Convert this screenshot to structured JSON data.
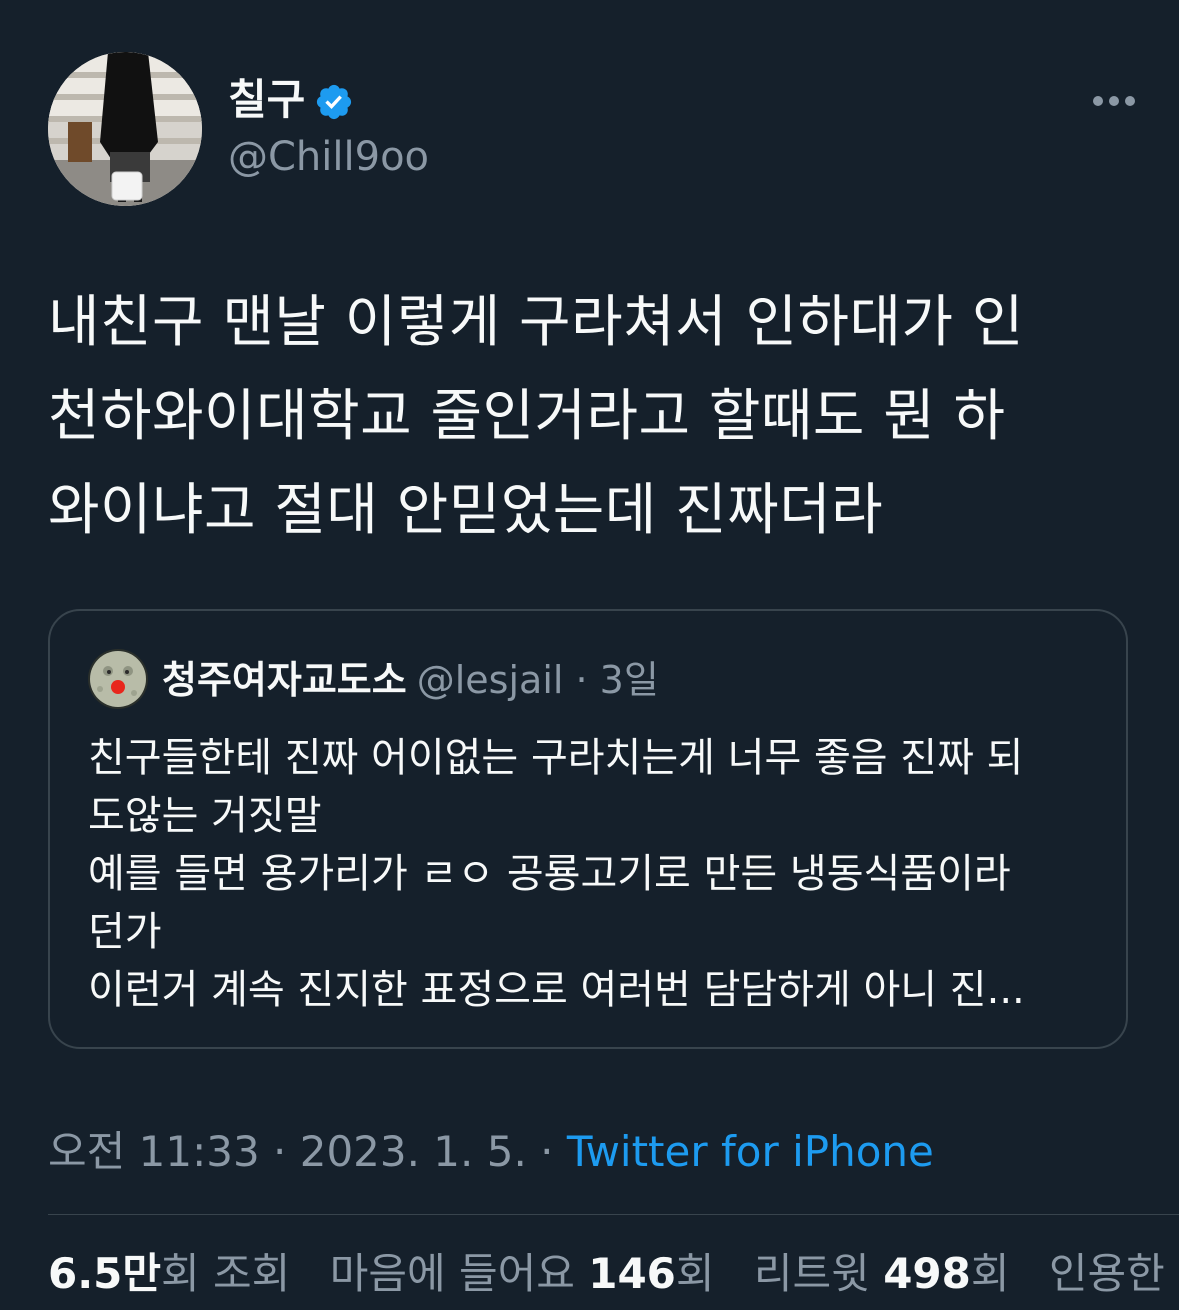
{
  "author": {
    "name": "칠구",
    "handle": "@Chill9oo"
  },
  "tweet": {
    "text": "내친구 맨날 이렇게 구라쳐서 인하대가 인\n천하와이대학교 줄인거라고 할때도 뭔 하\n와이냐고 절대 안믿었는데 진짜더라"
  },
  "quote": {
    "name": "청주여자교도소",
    "handle_and_time": "@lesjail · 3일",
    "text": "친구들한테 진짜 어이없는 구라치는게 너무 좋음 진짜 되\n도않는 거짓말\n예를 들면 용가리가 ㄹㅇ 공룡고기로 만든 냉동식품이라\n던가\n이런거 계속 진지한 표정으로 여러번 담담하게 아니 진..."
  },
  "timestamp": {
    "time_date": "오전 11:33 · 2023. 1. 5. · ",
    "source": "Twitter for iPhone"
  },
  "stats": {
    "views_num": "6.5만",
    "views_label": "회 조회",
    "likes_prefix": "마음에 들어요 ",
    "likes_num": "146",
    "likes_suffix": "회",
    "retweets_prefix": "리트윗 ",
    "retweets_num": "498",
    "retweets_suffix": "회",
    "quotes_label": "인용한 트윗"
  },
  "colors": {
    "background": "#15202b",
    "text_primary": "#f7f9f9",
    "text_secondary": "#8b98a5",
    "link": "#1d9bf0",
    "border": "#38444d",
    "verified": "#1d9bf0"
  },
  "icons": {
    "verified": "verified-badge-icon",
    "more": "more-options-icon"
  }
}
